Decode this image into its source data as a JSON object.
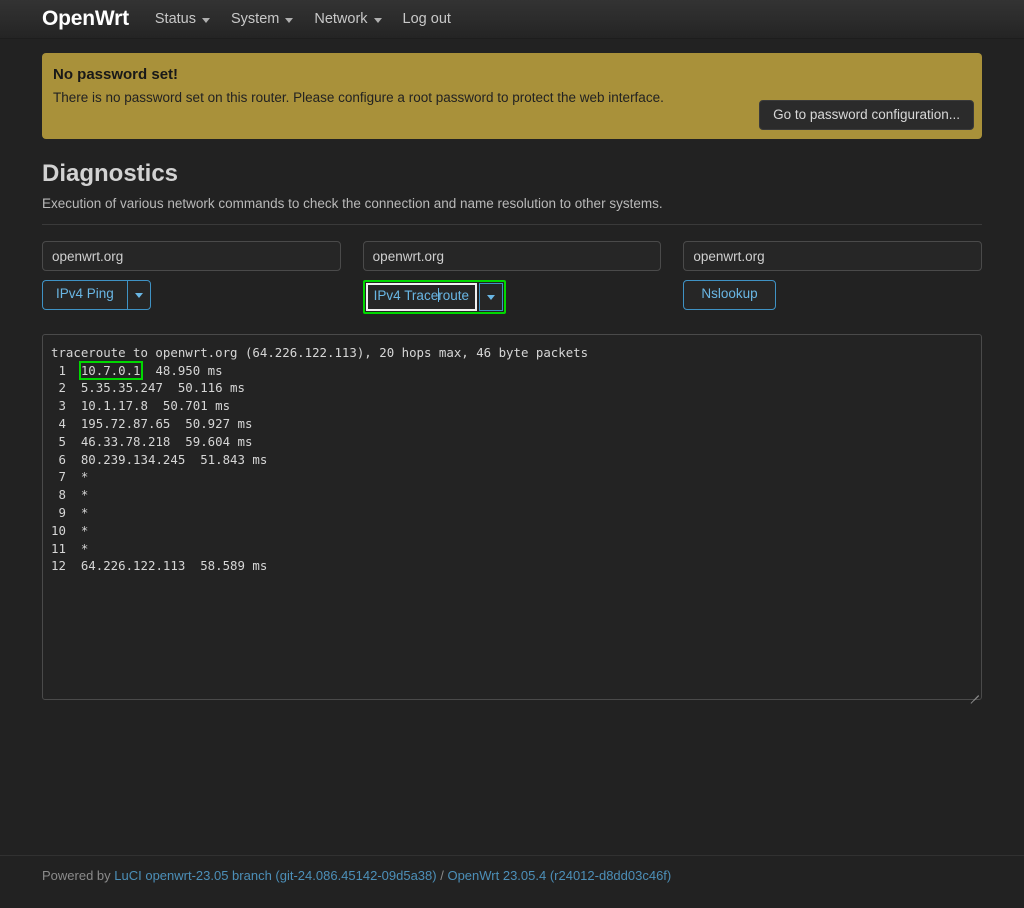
{
  "navbar": {
    "brand": "OpenWrt",
    "items": [
      {
        "label": "Status",
        "has_caret": true
      },
      {
        "label": "System",
        "has_caret": true
      },
      {
        "label": "Network",
        "has_caret": true
      },
      {
        "label": "Log out",
        "has_caret": false
      }
    ]
  },
  "alert": {
    "title": "No password set!",
    "text": "There is no password set on this router. Please configure a root password to protect the web interface.",
    "button_label": "Go to password configuration...",
    "background_color": "#a9913a"
  },
  "page": {
    "title": "Diagnostics",
    "subtitle": "Execution of various network commands to check the connection and name resolution to other systems."
  },
  "diagnostics": {
    "columns": [
      {
        "input_value": "openwrt.org",
        "input_placeholder": "",
        "button_label": "IPv4 Ping",
        "has_dropdown": true,
        "focused": false
      },
      {
        "input_value": "openwrt.org",
        "input_placeholder": "",
        "button_label_before_caret": "IPv4 Trace",
        "button_label_after_caret": "route",
        "button_label": "IPv4 Traceroute",
        "has_dropdown": true,
        "focused": true
      },
      {
        "input_value": "openwrt.org",
        "input_placeholder": "",
        "button_label": "Nslookup",
        "has_dropdown": false,
        "focused": false
      }
    ],
    "highlight_color": "#00d800"
  },
  "output": {
    "header_line": "traceroute to openwrt.org (64.226.122.113), 20 hops max, 46 byte packets",
    "highlighted_token": "10.7.0.1",
    "lines": [
      {
        "hop": " 1",
        "host": "10.7.0.1",
        "rtt": "48.950 ms",
        "highlight": true
      },
      {
        "hop": " 2",
        "host": "5.35.35.247",
        "rtt": "50.116 ms",
        "highlight": false
      },
      {
        "hop": " 3",
        "host": "10.1.17.8",
        "rtt": "50.701 ms",
        "highlight": false
      },
      {
        "hop": " 4",
        "host": "195.72.87.65",
        "rtt": "50.927 ms",
        "highlight": false
      },
      {
        "hop": " 5",
        "host": "46.33.78.218",
        "rtt": "59.604 ms",
        "highlight": false
      },
      {
        "hop": " 6",
        "host": "80.239.134.245",
        "rtt": "51.843 ms",
        "highlight": false
      },
      {
        "hop": " 7",
        "host": "*",
        "rtt": "",
        "highlight": false
      },
      {
        "hop": " 8",
        "host": "*",
        "rtt": "",
        "highlight": false
      },
      {
        "hop": " 9",
        "host": "*",
        "rtt": "",
        "highlight": false
      },
      {
        "hop": "10",
        "host": "*",
        "rtt": "",
        "highlight": false
      },
      {
        "hop": "11",
        "host": "*",
        "rtt": "",
        "highlight": false
      },
      {
        "hop": "12",
        "host": "64.226.122.113",
        "rtt": "58.589 ms",
        "highlight": false
      }
    ]
  },
  "footer": {
    "prefix": "Powered by ",
    "luci_link": "LuCI openwrt-23.05 branch (git-24.086.45142-09d5a38)",
    "separator": " / ",
    "openwrt_link": "OpenWrt 23.05.4 (r24012-d8dd03c46f)"
  }
}
